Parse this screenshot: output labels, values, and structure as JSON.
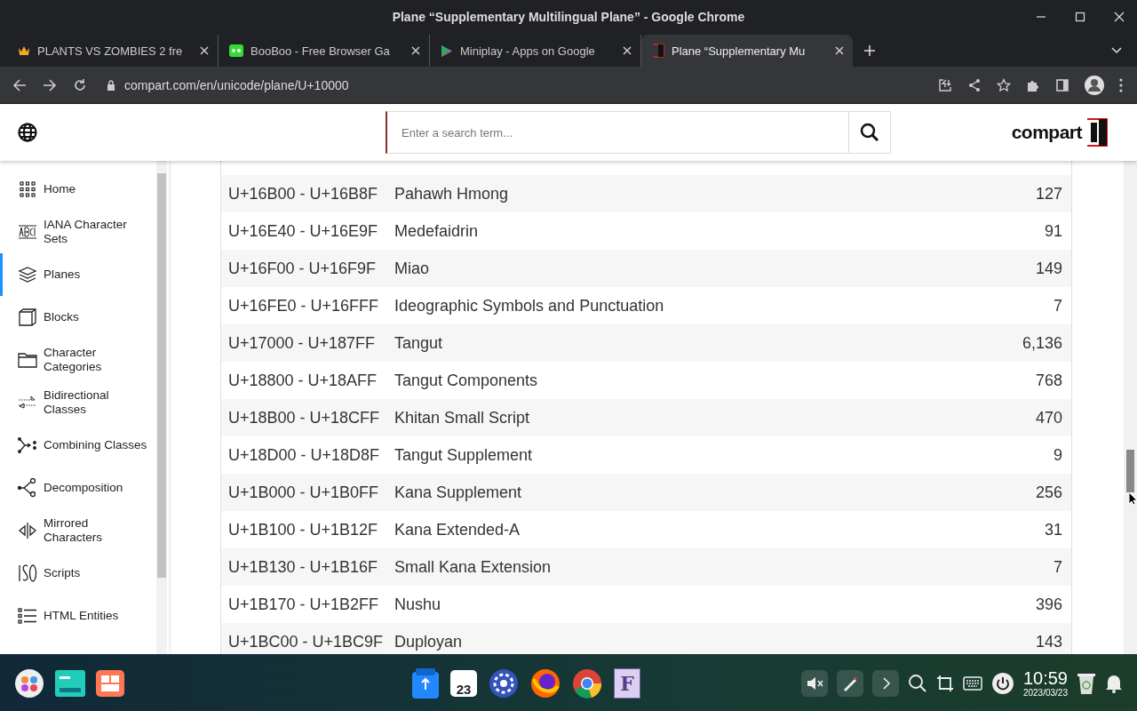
{
  "window": {
    "title": "Plane “Supplementary Multilingual Plane” - Google Chrome"
  },
  "tabs": [
    {
      "title": "PLANTS VS ZOMBIES 2 fre",
      "selected": false
    },
    {
      "title": "BooBoo - Free Browser Ga",
      "selected": false
    },
    {
      "title": "Miniplay - Apps on Google",
      "selected": false
    },
    {
      "title": "Plane “Supplementary Mu",
      "selected": true
    }
  ],
  "address": "compart.com/en/unicode/plane/U+10000",
  "header": {
    "placeholder": "Enter a search term...",
    "logo": "compart"
  },
  "sidebar": {
    "items": [
      {
        "label": "Home",
        "selected": false
      },
      {
        "label": "IANA Character Sets",
        "selected": false
      },
      {
        "label": "Planes",
        "selected": true
      },
      {
        "label": "Blocks",
        "selected": false
      },
      {
        "label": "Character Categories",
        "selected": false
      },
      {
        "label": "Bidirectional Classes",
        "selected": false
      },
      {
        "label": "Combining Classes",
        "selected": false
      },
      {
        "label": "Decomposition",
        "selected": false
      },
      {
        "label": "Mirrored Characters",
        "selected": false
      },
      {
        "label": "Scripts",
        "selected": false
      },
      {
        "label": "HTML Entities",
        "selected": false
      }
    ]
  },
  "table": {
    "rows": [
      {
        "range": "U+16B00 - U+16B8F",
        "name": "Pahawh Hmong",
        "count": "127"
      },
      {
        "range": "U+16E40 - U+16E9F",
        "name": "Medefaidrin",
        "count": "91"
      },
      {
        "range": "U+16F00 - U+16F9F",
        "name": "Miao",
        "count": "149"
      },
      {
        "range": "U+16FE0 - U+16FFF",
        "name": "Ideographic Symbols and Punctuation",
        "count": "7"
      },
      {
        "range": "U+17000 - U+187FF",
        "name": "Tangut",
        "count": "6,136"
      },
      {
        "range": "U+18800 - U+18AFF",
        "name": "Tangut Components",
        "count": "768"
      },
      {
        "range": "U+18B00 - U+18CFF",
        "name": "Khitan Small Script",
        "count": "470"
      },
      {
        "range": "U+18D00 - U+18D8F",
        "name": "Tangut Supplement",
        "count": "9"
      },
      {
        "range": "U+1B000 - U+1B0FF",
        "name": "Kana Supplement",
        "count": "256"
      },
      {
        "range": "U+1B100 - U+1B12F",
        "name": "Kana Extended-A",
        "count": "31"
      },
      {
        "range": "U+1B130 - U+1B16F",
        "name": "Small Kana Extension",
        "count": "7"
      },
      {
        "range": "U+1B170 - U+1B2FF",
        "name": "Nushu",
        "count": "396"
      },
      {
        "range": "U+1BC00 - U+1BC9F",
        "name": "Duployan",
        "count": "143"
      }
    ]
  },
  "taskbar": {
    "calendar_day": "23",
    "font_app_letter": "F",
    "time": "10:59",
    "date": "2023/03/23"
  }
}
